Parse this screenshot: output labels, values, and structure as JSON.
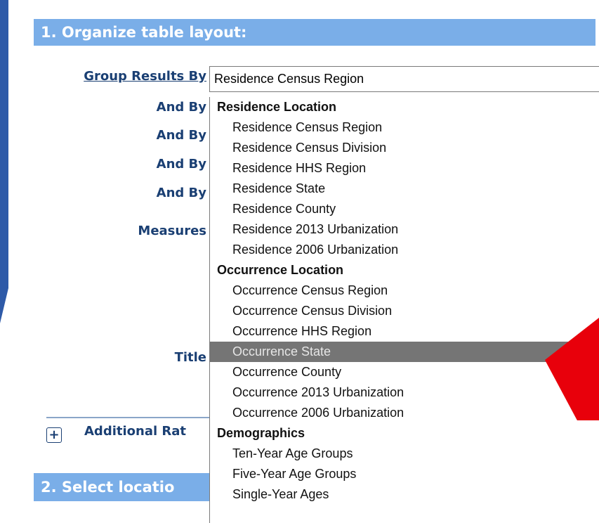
{
  "colors": {
    "slide_blue": "#2e5aa8",
    "section_header_bg": "#7aaee8",
    "label_text": "#1a3f73",
    "highlight_bg": "#757575",
    "arrow_red": "#e8000b"
  },
  "section1": {
    "title": "1. Organize table layout:"
  },
  "form": {
    "group_by_label": "Group Results By",
    "and_by_labels": [
      "And By",
      "And By",
      "And By",
      "And By"
    ],
    "measures_label": "Measures",
    "title_label": "Title",
    "expand_icon": "+",
    "additional_label": "Additional Rat"
  },
  "group_select": {
    "selected_value": "Residence Census Region"
  },
  "dropdown": {
    "groups": [
      {
        "label": "Residence Location",
        "options": [
          "Residence Census Region",
          "Residence Census Division",
          "Residence HHS Region",
          "Residence State",
          "Residence County",
          "Residence 2013 Urbanization",
          "Residence 2006 Urbanization"
        ]
      },
      {
        "label": "Occurrence Location",
        "options": [
          "Occurrence Census Region",
          "Occurrence Census Division",
          "Occurrence HHS Region",
          "Occurrence State",
          "Occurrence County",
          "Occurrence 2013 Urbanization",
          "Occurrence 2006 Urbanization"
        ]
      },
      {
        "label": "Demographics",
        "options": [
          "Ten-Year Age Groups",
          "Five-Year Age Groups",
          "Single-Year Ages"
        ]
      }
    ],
    "highlighted_option": "Occurrence State"
  },
  "section2": {
    "title": "2. Select locatio"
  },
  "annotation": {
    "icon": "red-arrow-icon"
  }
}
